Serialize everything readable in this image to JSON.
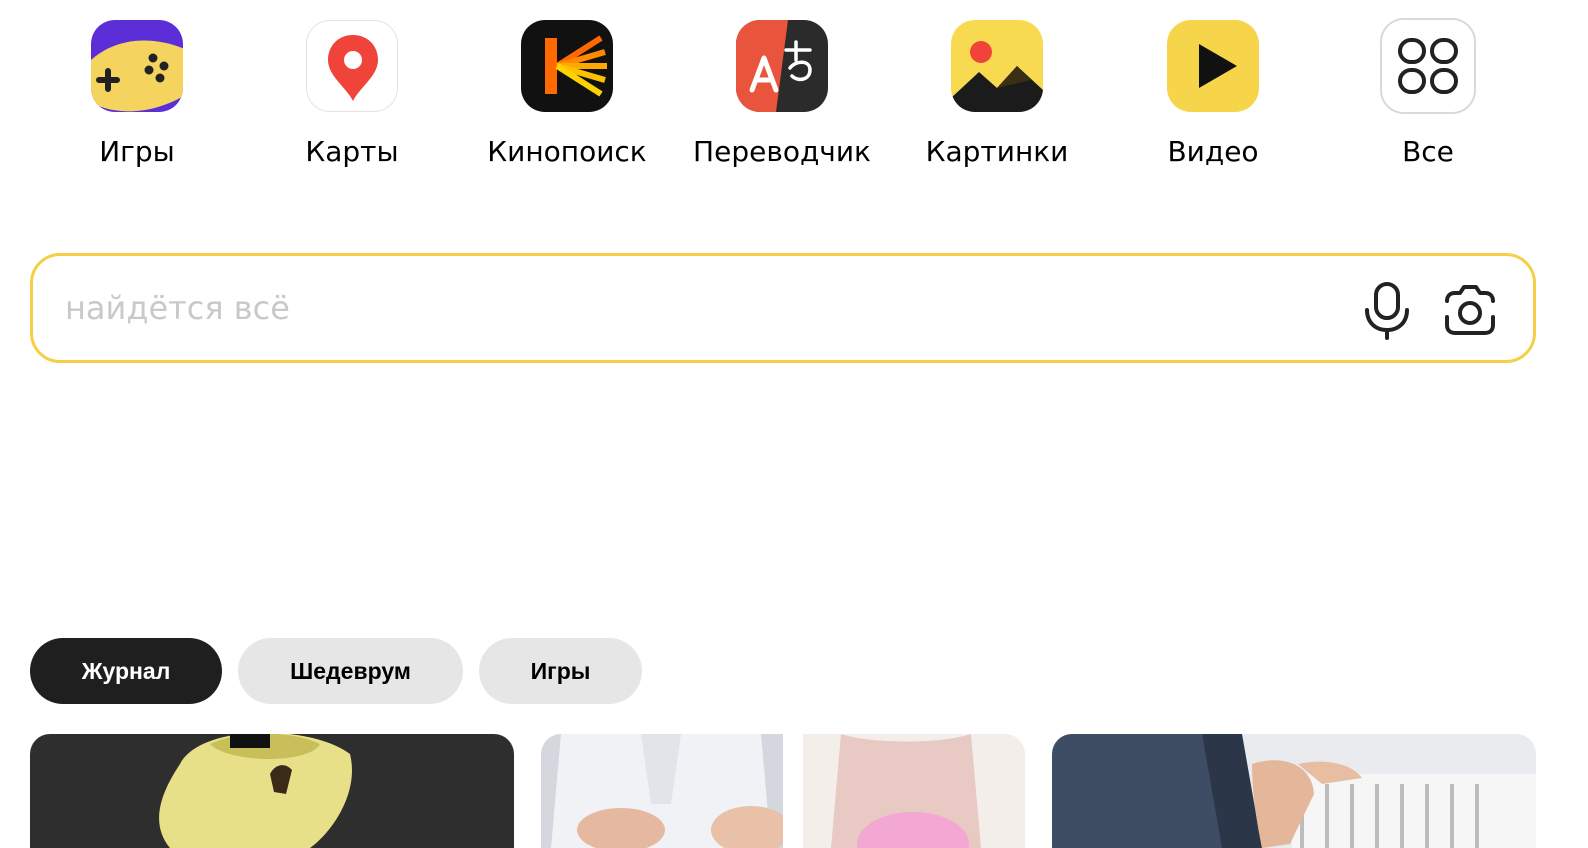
{
  "services": [
    {
      "label": "Игры",
      "icon": "gamepad-icon"
    },
    {
      "label": "Карты",
      "icon": "map-pin-icon"
    },
    {
      "label": "Кинопоиск",
      "icon": "kinopoisk-icon"
    },
    {
      "label": "Переводчик",
      "icon": "translator-icon"
    },
    {
      "label": "Картинки",
      "icon": "images-icon"
    },
    {
      "label": "Видео",
      "icon": "play-icon"
    },
    {
      "label": "Все",
      "icon": "grid-icon"
    }
  ],
  "search": {
    "placeholder": "найдётся всё",
    "value": "",
    "icons": [
      "microphone-icon",
      "camera-icon"
    ],
    "border_color": "#f5cf45"
  },
  "tabs": [
    {
      "label": "Журнал",
      "active": true
    },
    {
      "label": "Шедеврум",
      "active": false
    },
    {
      "label": "Игры",
      "active": false
    }
  ],
  "colors": {
    "accent_yellow": "#f5cf45",
    "tab_active_bg": "#1f1f1f",
    "tab_inactive_bg": "#e6e6e6"
  }
}
